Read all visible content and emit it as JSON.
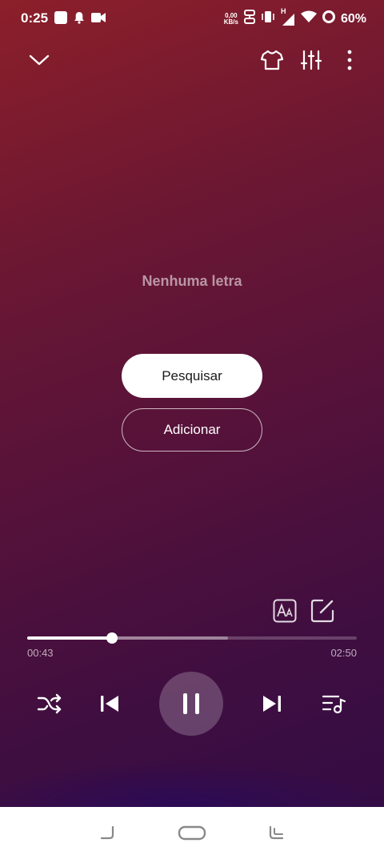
{
  "status_bar": {
    "time": "0:25",
    "net_speed_value": "0,00",
    "net_speed_unit": "KB/s",
    "signal_type": "H",
    "battery_percent": "60%"
  },
  "top_bar": {
    "icons": [
      "chevron-down-icon",
      "tshirt-icon",
      "equalizer-icon",
      "more-vert-icon"
    ]
  },
  "lyrics": {
    "empty_text": "Nenhuma letra",
    "search_label": "Pesquisar",
    "add_label": "Adicionar"
  },
  "lyric_tools": {
    "icons": [
      "font-size-icon",
      "edit-icon"
    ]
  },
  "player": {
    "elapsed": "00:43",
    "duration": "02:50",
    "progress_fraction": 0.257,
    "buffered_fraction": 0.61,
    "state": "playing"
  },
  "controls": {
    "icons": [
      "shuffle-icon",
      "previous-icon",
      "pause-icon",
      "next-icon",
      "playlist-icon"
    ]
  },
  "nav_bar": {
    "icons": [
      "back-gesture-icon",
      "home-gesture-icon",
      "recents-gesture-icon"
    ]
  },
  "colors": {
    "background_top": "#8c1f2a",
    "background_bottom": "#340c44",
    "accent": "#ffffff"
  }
}
